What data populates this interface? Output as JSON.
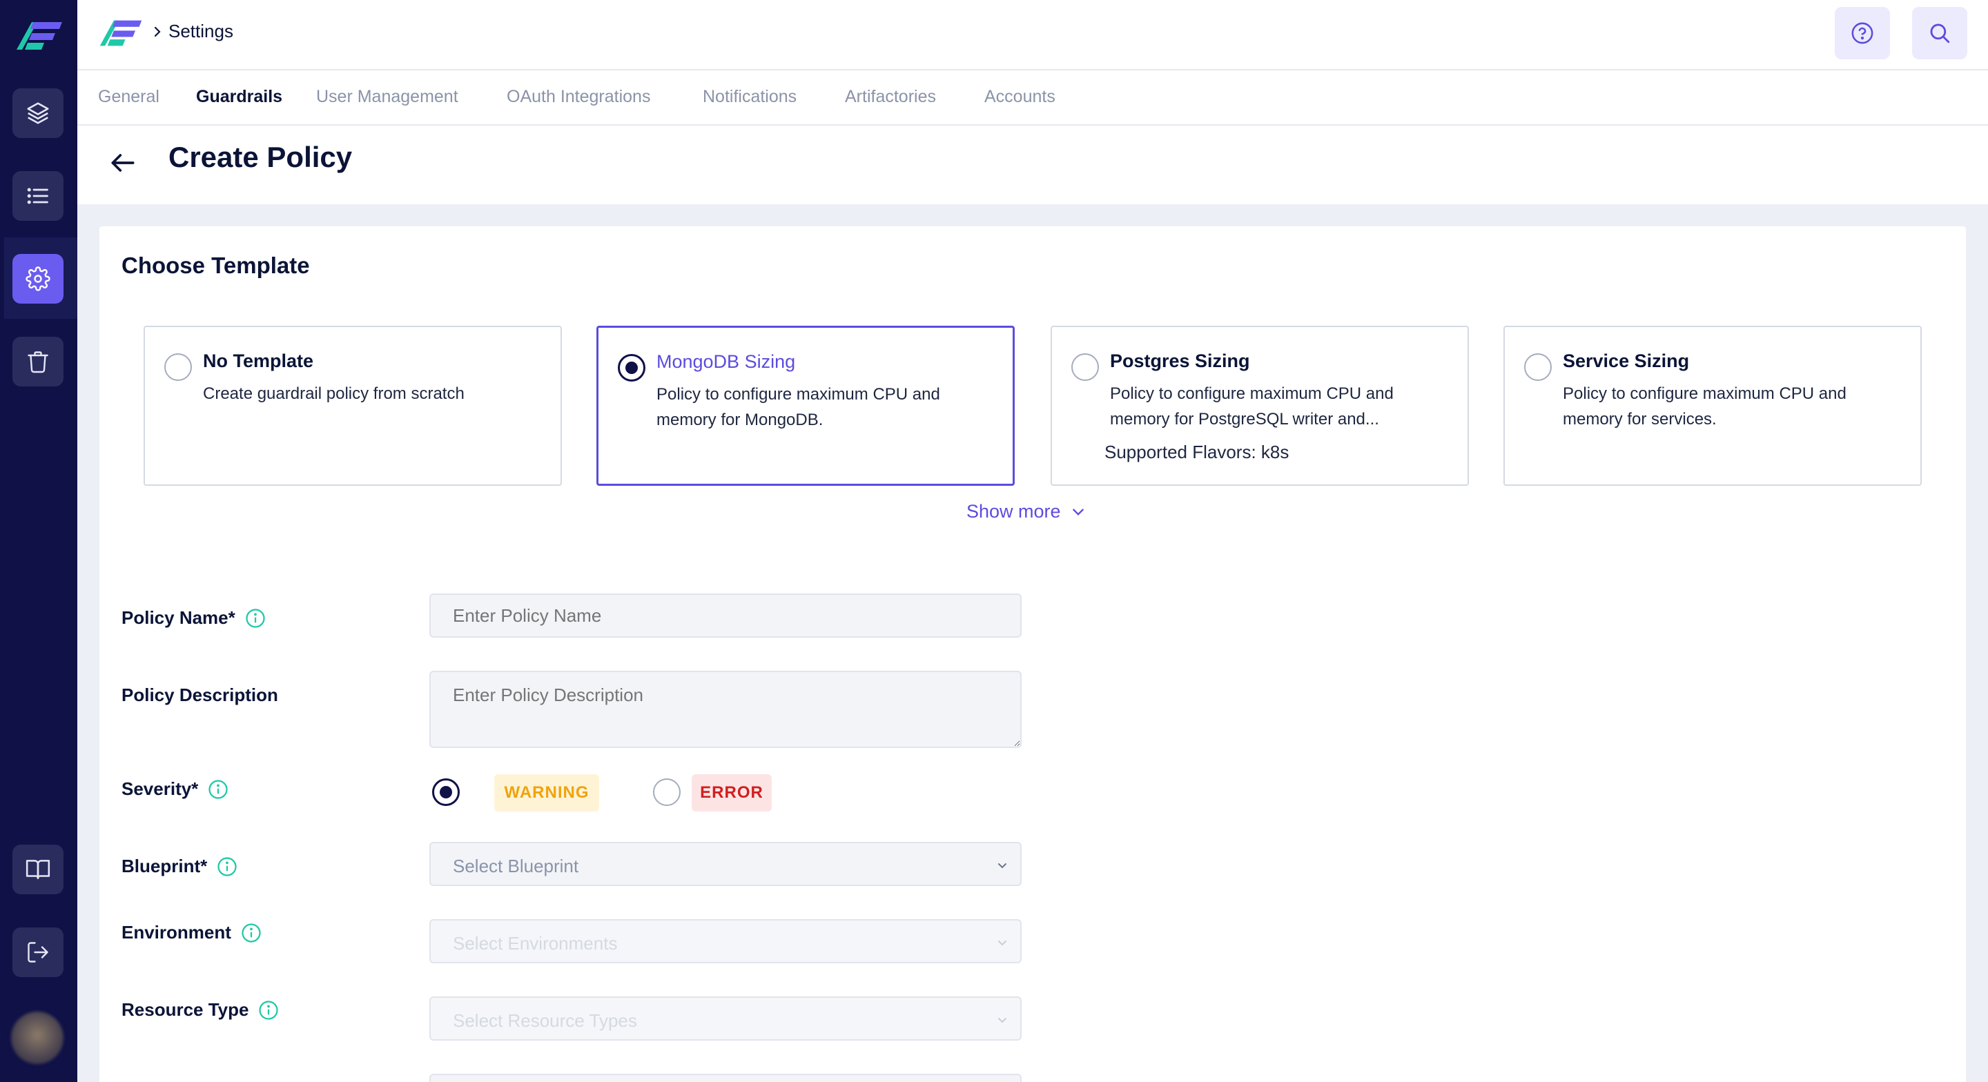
{
  "app": {
    "breadcrumb_title": "Settings"
  },
  "tabs": [
    {
      "label": "General"
    },
    {
      "label": "Guardrails"
    },
    {
      "label": "User Management"
    },
    {
      "label": "OAuth Integrations"
    },
    {
      "label": "Notifications"
    },
    {
      "label": "Artifactories"
    },
    {
      "label": "Accounts"
    }
  ],
  "active_tab": "Guardrails",
  "page": {
    "title": "Create Policy"
  },
  "templates": {
    "heading": "Choose Template",
    "items": [
      {
        "name": "No Template",
        "description": "Create guardrail policy from scratch",
        "selected": false
      },
      {
        "name": "MongoDB Sizing",
        "description": "Policy to configure maximum CPU and memory for MongoDB.",
        "selected": true
      },
      {
        "name": "Postgres Sizing",
        "description": "Policy to configure maximum CPU and memory for PostgreSQL writer and...",
        "flavors": "Supported Flavors: k8s",
        "selected": false
      },
      {
        "name": "Service Sizing",
        "description": "Policy to configure maximum CPU and memory for services.",
        "selected": false
      }
    ],
    "show_more": "Show more"
  },
  "form": {
    "policy_name": {
      "label": "Policy Name*",
      "placeholder": "Enter Policy Name",
      "value": ""
    },
    "policy_description": {
      "label": "Policy Description",
      "placeholder": "Enter Policy Description",
      "value": ""
    },
    "severity": {
      "label": "Severity*",
      "options": [
        "WARNING",
        "ERROR"
      ],
      "selected": "WARNING"
    },
    "blueprint": {
      "label": "Blueprint*",
      "placeholder": "Select Blueprint"
    },
    "environment": {
      "label": "Environment",
      "placeholder": "Select Environments"
    },
    "resource_type": {
      "label": "Resource Type",
      "placeholder": "Select Resource Types"
    }
  },
  "colors": {
    "sidebar_bg": "#0f1147",
    "accent": "#5b4cde",
    "warning_bg": "#fff3d6",
    "warning_text": "#f0a30a",
    "error_bg": "#fde4e4",
    "error_text": "#d11f1f"
  },
  "icons": {
    "sidebar": [
      "layers-icon",
      "list-icon",
      "gear-icon",
      "trash-icon",
      "book-icon",
      "logout-icon"
    ],
    "topbar": [
      "help-icon",
      "search-icon"
    ]
  }
}
